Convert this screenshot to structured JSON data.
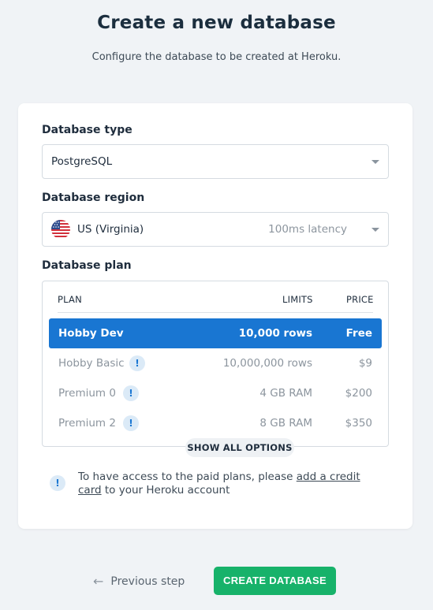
{
  "header": {
    "title": "Create a new database",
    "subtitle": "Configure the database to be created at Heroku."
  },
  "form": {
    "type": {
      "label": "Database type",
      "value": "PostgreSQL"
    },
    "region": {
      "label": "Database region",
      "value": "US (Virginia)",
      "latency": "100ms latency",
      "flag_icon": "us-flag-icon"
    },
    "plan": {
      "label": "Database plan",
      "columns": {
        "plan": "PLAN",
        "limits": "LIMITS",
        "price": "PRICE"
      },
      "rows": [
        {
          "name": "Hobby Dev",
          "limits": "10,000 rows",
          "price": "Free",
          "selected": true,
          "info": false
        },
        {
          "name": "Hobby Basic",
          "limits": "10,000,000 rows",
          "price": "$9",
          "selected": false,
          "info": true
        },
        {
          "name": "Premium 0",
          "limits": "4 GB RAM",
          "price": "$200",
          "selected": false,
          "info": true
        },
        {
          "name": "Premium 2",
          "limits": "8 GB RAM",
          "price": "$350",
          "selected": false,
          "info": true
        }
      ],
      "show_all": "SHOW ALL OPTIONS"
    }
  },
  "notice": {
    "before": "To have access to the paid plans, please ",
    "link": "add a credit card",
    "after": " to your Heroku account"
  },
  "footer": {
    "previous": "Previous step",
    "create": "CREATE DATABASE"
  },
  "colors": {
    "accent_blue": "#1976d2",
    "create_green": "#17b26a"
  }
}
